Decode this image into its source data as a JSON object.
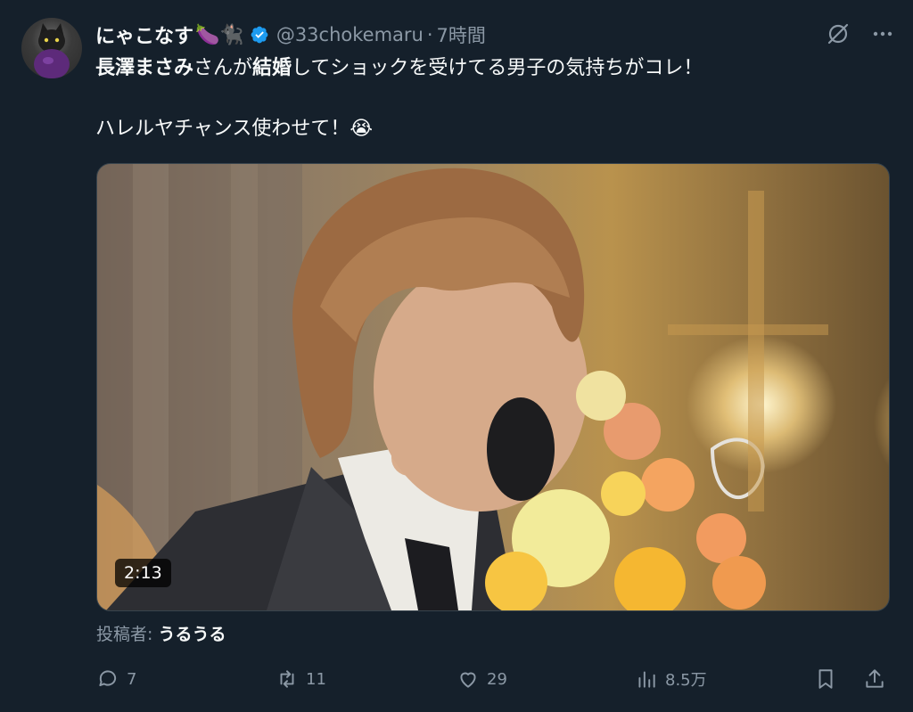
{
  "tweet": {
    "display_name": "にゃこなす",
    "name_emojis": "🍆🐈‍⬛",
    "handle": "@33chokemaru",
    "separator": "·",
    "time": "7時間",
    "line1_bold1": "長澤まさみ",
    "line1_mid": "さんが",
    "line1_bold2": "結婚",
    "line1_rest": "してショックを受けてる男子の気持ちがコレ！",
    "line2": "ハレルヤチャンス使わせて！😭",
    "video_duration": "2:13",
    "posted_by_label": "投稿者: ",
    "posted_by_name": "うるうる"
  },
  "metrics": {
    "replies": "7",
    "reposts": "11",
    "likes": "29",
    "views": "8.5万"
  },
  "colors": {
    "background": "#15202b",
    "text": "#f7f9f9",
    "muted": "#8b98a5",
    "verified": "#1d9bf0"
  }
}
